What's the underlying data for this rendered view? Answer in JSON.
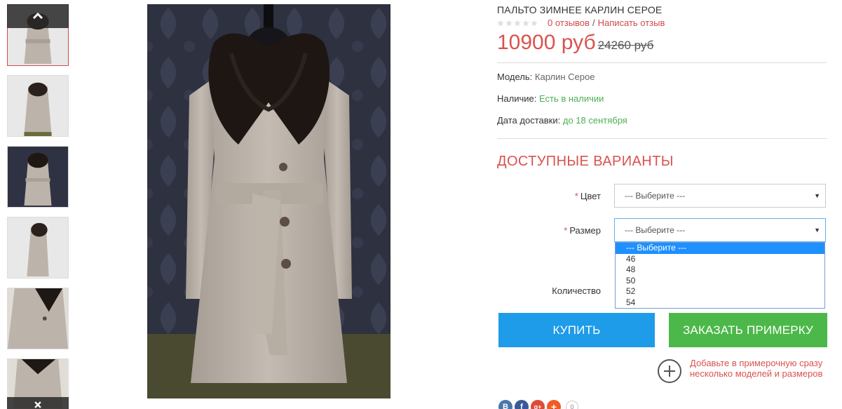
{
  "product": {
    "title": "ПАЛЬТО ЗИМНЕЕ КАРЛИН СЕРОЕ",
    "rating": 0,
    "reviews_link": "0 отзывов",
    "rating_sep": "/",
    "write_review_link": "Написать отзыв",
    "price_new": "10900 руб",
    "price_old": "24260 руб"
  },
  "specs": {
    "model_label": "Модель:",
    "model_value": "Карлин Серое",
    "availability_label": "Наличие:",
    "availability_value": "Есть в наличии",
    "delivery_label": "Дата доставки:",
    "delivery_value": "до 18 сентября"
  },
  "options": {
    "title": "ДОСТУПНЫЕ ВАРИАНТЫ",
    "required_mark": "*",
    "color_label": "Цвет",
    "color_value": "--- Выберите ---",
    "size_label": "Размер",
    "size_value": "--- Выберите ---",
    "size_options": [
      "--- Выберите ---",
      "46",
      "48",
      "50",
      "52",
      "54"
    ],
    "quantity_label": "Количество"
  },
  "buttons": {
    "buy": "КУПИТЬ",
    "fitting": "ЗАКАЗАТЬ ПРИМЕРКУ"
  },
  "fitting_note": "Добавьте в примерочную сразу несколько моделей и размеров",
  "social": {
    "count": "0",
    "items": [
      {
        "name": "vk-icon",
        "glyph": "B",
        "color": "#4a76a8"
      },
      {
        "name": "facebook-icon",
        "glyph": "f",
        "color": "#3b5998"
      },
      {
        "name": "google-plus-icon",
        "glyph": "g+",
        "color": "#dd4b39"
      },
      {
        "name": "share-plus-icon",
        "glyph": "+",
        "color": "#f05a24"
      }
    ]
  },
  "colors": {
    "accent_red": "#d9534f",
    "buy_blue": "#1e9be9",
    "fitting_green": "#4cb849",
    "available_green": "#4caf50"
  }
}
